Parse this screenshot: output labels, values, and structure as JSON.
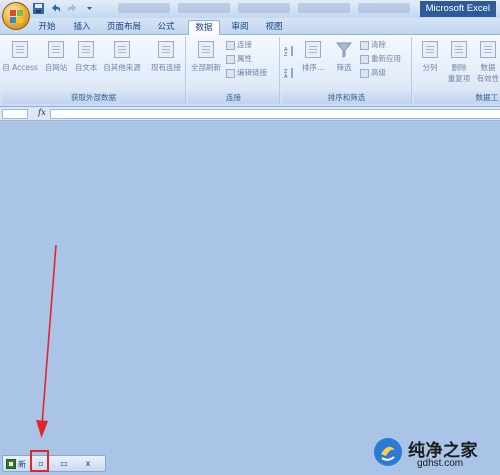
{
  "window": {
    "app_title": "Microsoft Excel"
  },
  "tabs": [
    {
      "label": "开始",
      "active": false
    },
    {
      "label": "插入",
      "active": false
    },
    {
      "label": "页面布局",
      "active": false
    },
    {
      "label": "公式",
      "active": false
    },
    {
      "label": "数据",
      "active": true
    },
    {
      "label": "审阅",
      "active": false
    },
    {
      "label": "视图",
      "active": false
    }
  ],
  "ribbon": {
    "get_external": {
      "label": "获取外部数据",
      "access": "自 Access",
      "web": "自网站",
      "text": "自文本",
      "other": "自其他来源",
      "existing": "现有连接"
    },
    "connections": {
      "label": "连接",
      "refresh_all": "全部刷新",
      "connect": "连接",
      "properties": "属性",
      "edit_links": "编辑链接"
    },
    "sort_filter": {
      "label": "排序和筛选",
      "sort": "排序...",
      "filter": "筛选",
      "clear": "清除",
      "reapply": "重新应用",
      "advanced": "高级"
    },
    "data_tools": {
      "label": "数据工",
      "split": "分列",
      "remove_dup_line1": "删除",
      "remove_dup_line2": "重复项",
      "validation_line1": "数据",
      "validation_line2": "有效性"
    }
  },
  "formula_bar": {
    "fx_label": "fx",
    "value": ""
  },
  "minimized_window": {
    "title": "新",
    "restore_glyph": "▫",
    "maximize_glyph": "▭",
    "close_glyph": "x"
  },
  "watermark": {
    "main": "纯净之家",
    "sub": "gdhst.com"
  },
  "colors": {
    "workspace": "#a9c4e6",
    "highlight_border": "#e0262b",
    "arrow": "#e0262b",
    "ribbon_text": "#15428b"
  }
}
